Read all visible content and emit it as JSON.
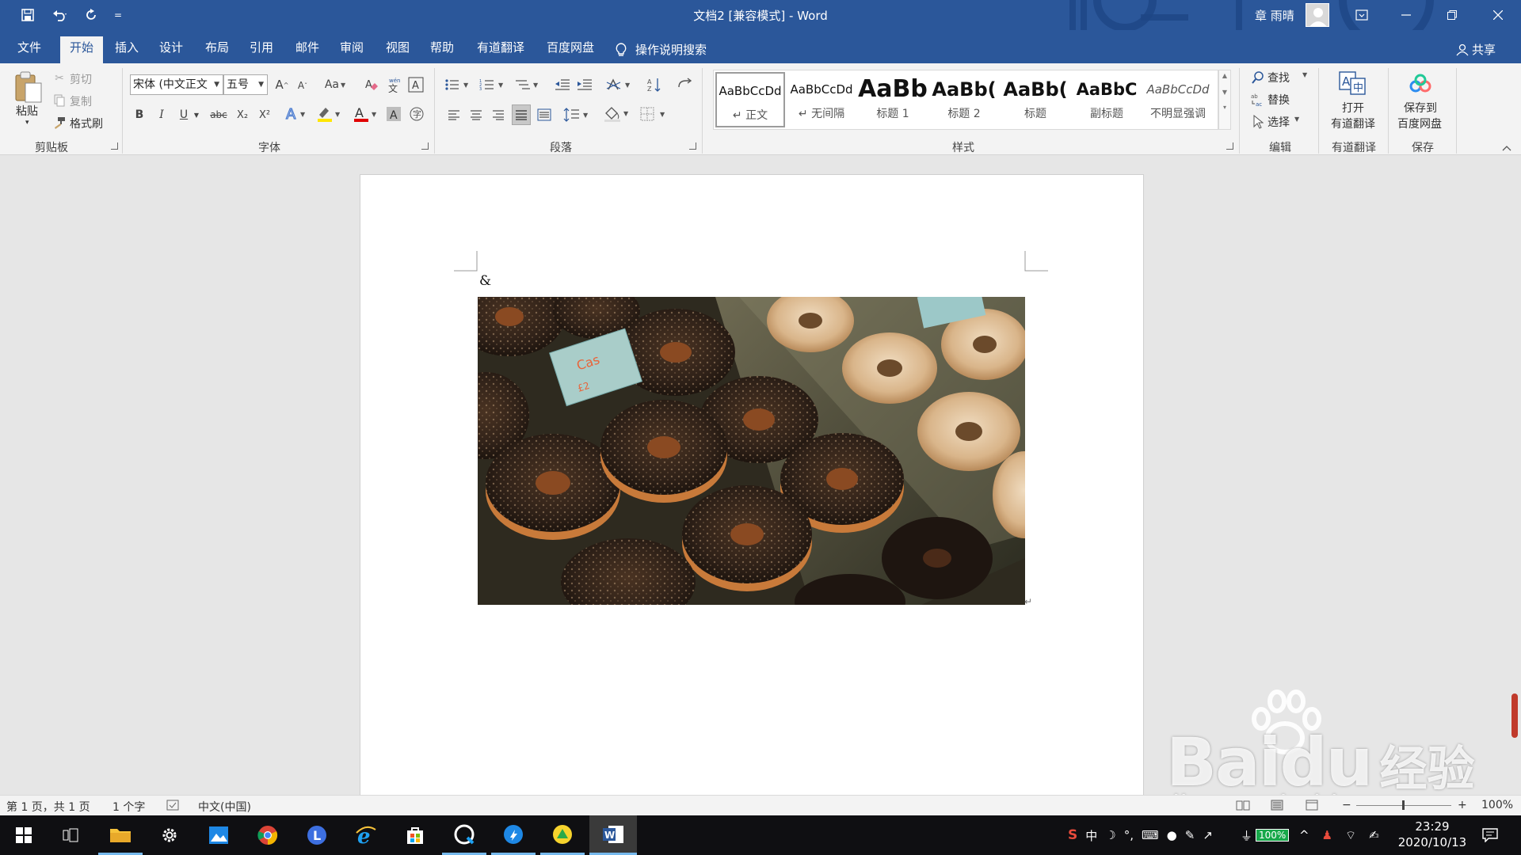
{
  "title_bar": {
    "doc_title": "文档2 [兼容模式]  -  Word",
    "user_name": "章 雨晴",
    "qat_more": "="
  },
  "ribbon_tabs": [
    {
      "label": "文件"
    },
    {
      "label": "开始",
      "active": true
    },
    {
      "label": "插入"
    },
    {
      "label": "设计"
    },
    {
      "label": "布局"
    },
    {
      "label": "引用"
    },
    {
      "label": "邮件"
    },
    {
      "label": "审阅"
    },
    {
      "label": "视图"
    },
    {
      "label": "帮助"
    },
    {
      "label": "有道翻译"
    },
    {
      "label": "百度网盘"
    }
  ],
  "tell_me": "操作说明搜索",
  "share": "共享",
  "clipboard": {
    "paste": "粘贴",
    "cut": "剪切",
    "copy": "复制",
    "format_painter": "格式刷",
    "group_label": "剪贴板"
  },
  "font": {
    "font_name": "宋体 (中文正文",
    "font_size": "五号",
    "change_case": "Aa",
    "bold": "B",
    "italic": "I",
    "underline": "U",
    "strike": "abc",
    "subscript": "X₂",
    "superscript": "X²",
    "font_color_letter": "A",
    "char_shading_letter": "A",
    "group_label": "字体"
  },
  "paragraph": {
    "group_label": "段落"
  },
  "styles": {
    "items": [
      {
        "sample": "AaBbCcDd",
        "name": "↵ 正文"
      },
      {
        "sample": "AaBbCcDd",
        "name": "↵ 无间隔"
      },
      {
        "sample": "AaBb",
        "name": "标题 1"
      },
      {
        "sample": "AaBb(",
        "name": "标题 2"
      },
      {
        "sample": "AaBb(",
        "name": "标题"
      },
      {
        "sample": "AaBbC",
        "name": "副标题"
      },
      {
        "sample": "AaBbCcDd",
        "name": "不明显强调"
      }
    ],
    "group_label": "样式"
  },
  "editing": {
    "find": "查找",
    "replace": "替换",
    "select": "选择",
    "group_label": "编辑"
  },
  "youdao": {
    "open_line1": "打开",
    "open_line2": "有道翻译",
    "group_label": "有道翻译"
  },
  "baidu": {
    "save_line1": "保存到",
    "save_line2": "百度网盘",
    "group_label": "保存"
  },
  "document": {
    "first_paragraph": "&",
    "image_description": "photo of chocolate-sprinkled donuts"
  },
  "status_bar": {
    "page_info": "第 1 页，共 1 页",
    "word_count": "1 个字",
    "language": "中文(中国)",
    "zoom": "100%"
  },
  "watermark": {
    "brand": "Bai",
    "brand2": "du",
    "cn": "经验",
    "url": "jingyan.baidu.com"
  },
  "taskbar": {
    "ime": "中",
    "battery": "100%",
    "time": "23:29",
    "date": "2020/10/13"
  },
  "colors": {
    "word_blue": "#2b579a",
    "font_color_red": "#e00000",
    "highlight_yellow": "#ffe600"
  }
}
